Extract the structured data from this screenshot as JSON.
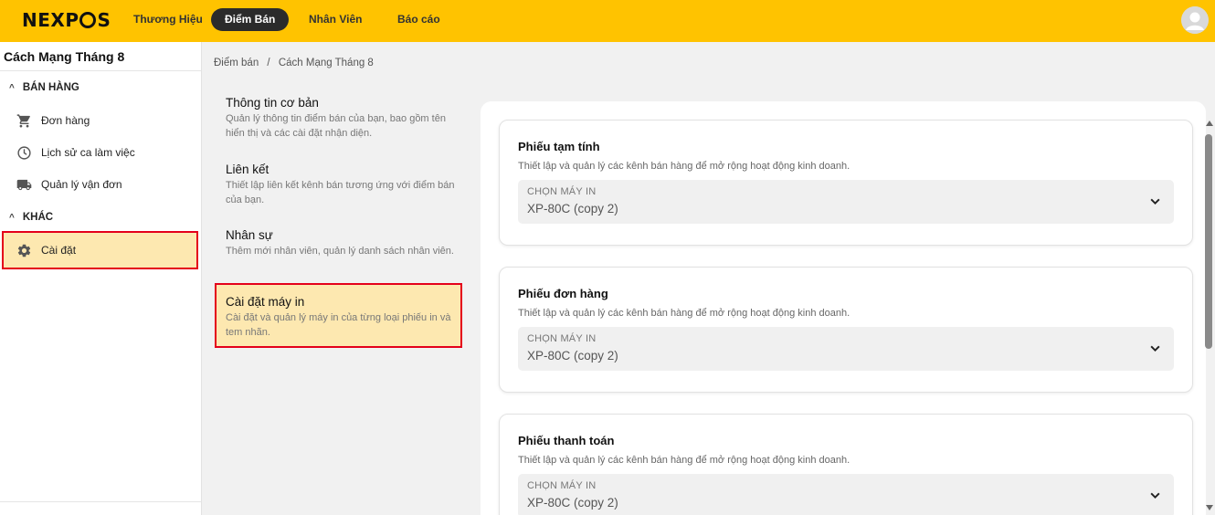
{
  "brand": {
    "logo_pre": "NEXP",
    "logo_post": "S",
    "accent": "#ffc300"
  },
  "nav": {
    "tabs": [
      {
        "label": "Thương Hiệu",
        "active": false
      },
      {
        "label": "Điểm Bán",
        "active": true
      },
      {
        "label": "Nhân Viên",
        "active": false
      },
      {
        "label": "Báo cáo",
        "active": false
      }
    ]
  },
  "sidebar": {
    "store_name": "Cách Mạng Tháng 8",
    "sections": [
      {
        "title": "BÁN HÀNG",
        "items": [
          {
            "label": "Đơn hàng",
            "icon": "cart-icon"
          },
          {
            "label": "Lịch sử ca làm việc",
            "icon": "clock-icon"
          },
          {
            "label": "Quản lý vận đơn",
            "icon": "truck-icon"
          }
        ]
      },
      {
        "title": "KHÁC",
        "items": [
          {
            "label": "Cài đặt",
            "icon": "gear-icon",
            "active": true
          }
        ]
      }
    ]
  },
  "breadcrumb": {
    "root": "Điểm bán",
    "sep": "/",
    "current": "Cách Mạng Tháng 8"
  },
  "settings_menu": [
    {
      "title": "Thông tin cơ bản",
      "desc": "Quản lý thông tin điểm bán của bạn, bao gồm tên hiển thị và các cài đặt nhận diện."
    },
    {
      "title": "Liên kết",
      "desc": "Thiết lập liên kết kênh bán tương ứng với điểm bán của bạn."
    },
    {
      "title": "Nhân sự",
      "desc": "Thêm mới nhân viên, quản lý danh sách nhân viên."
    },
    {
      "title": "Cài đặt máy in",
      "desc": "Cài đặt và quản lý máy in của từng loại phiếu in và tem nhãn.",
      "active": true
    }
  ],
  "printer_cards": [
    {
      "title": "Phiếu tạm tính",
      "desc": "Thiết lập và quản lý các kênh bán hàng để mở rộng hoạt động kinh doanh.",
      "select_label": "CHỌN MÁY IN",
      "select_value": "XP-80C (copy 2)"
    },
    {
      "title": "Phiếu đơn hàng",
      "desc": "Thiết lập và quản lý các kênh bán hàng để mở rộng hoạt động kinh doanh.",
      "select_label": "CHỌN MÁY IN",
      "select_value": "XP-80C (copy 2)"
    },
    {
      "title": "Phiếu thanh toán",
      "desc": "Thiết lập và quản lý các kênh bán hàng để mở rộng hoạt động kinh doanh.",
      "select_label": "CHỌN MÁY IN",
      "select_value": "XP-80C (copy 2)"
    }
  ]
}
